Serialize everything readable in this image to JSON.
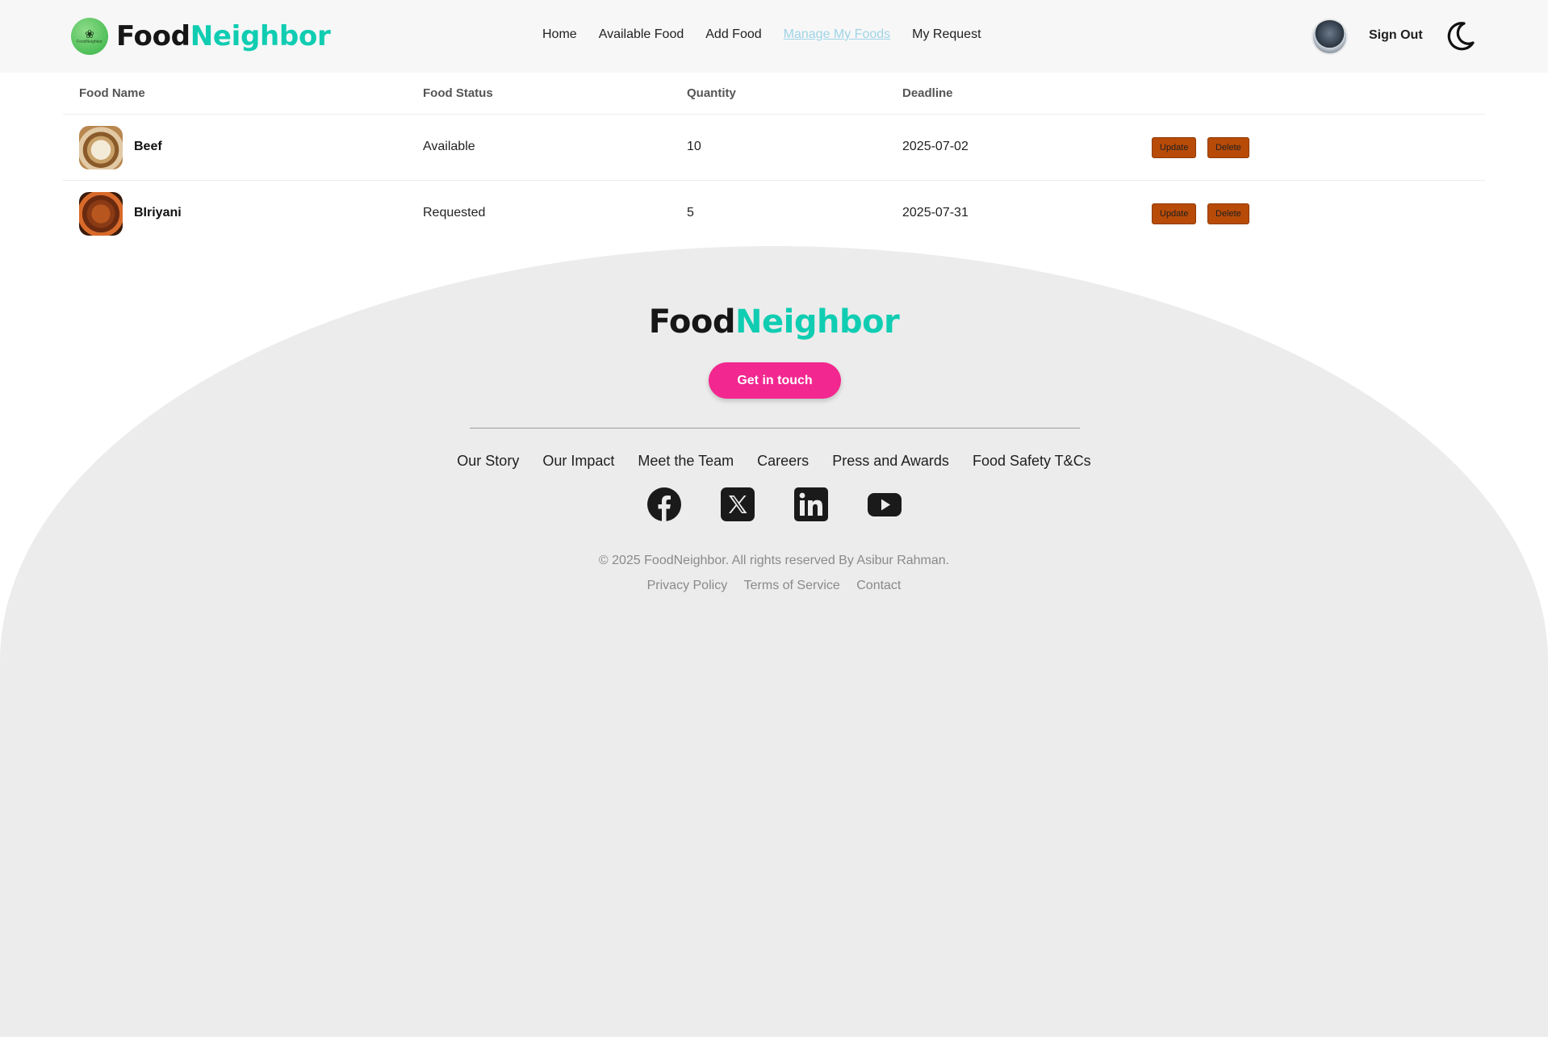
{
  "nav": {
    "brand_part1": "Food",
    "brand_part2": "Neighbor",
    "logo_text": "FoodNeighbor",
    "links": [
      "Home",
      "Available Food",
      "Add Food",
      "Manage My Foods",
      "My Request"
    ],
    "active_link": "Manage My Foods",
    "sign_out": "Sign Out",
    "theme_icon": "moon-icon"
  },
  "table": {
    "headers": [
      "Food Name",
      "Food Status",
      "Quantity",
      "Deadline"
    ],
    "rows": [
      {
        "name": "Beef",
        "status": "Available",
        "quantity": "10",
        "deadline": "2025-07-02",
        "update": "Update",
        "delete": "Delete"
      },
      {
        "name": "BIriyani",
        "status": "Requested",
        "quantity": "5",
        "deadline": "2025-07-31",
        "update": "Update",
        "delete": "Delete"
      }
    ]
  },
  "footer": {
    "brand_part1": "Food",
    "brand_part2": "Neighbor",
    "cta": "Get in touch",
    "links": [
      "Our Story",
      "Our Impact",
      "Meet the Team",
      "Careers",
      "Press and Awards",
      "Food Safety T&Cs"
    ],
    "socials": [
      "facebook-icon",
      "x-icon",
      "linkedin-icon",
      "youtube-icon"
    ],
    "copyright": "© 2025 FoodNeighbor. All rights reserved By Asibur Rahman.",
    "legal": [
      "Privacy Policy",
      "Terms of Service",
      "Contact"
    ]
  },
  "colors": {
    "brand_teal": "#10cdb2",
    "cta_pink": "#f2278f",
    "button_orange": "#b84b08",
    "active_link": "#9fd3e6"
  }
}
